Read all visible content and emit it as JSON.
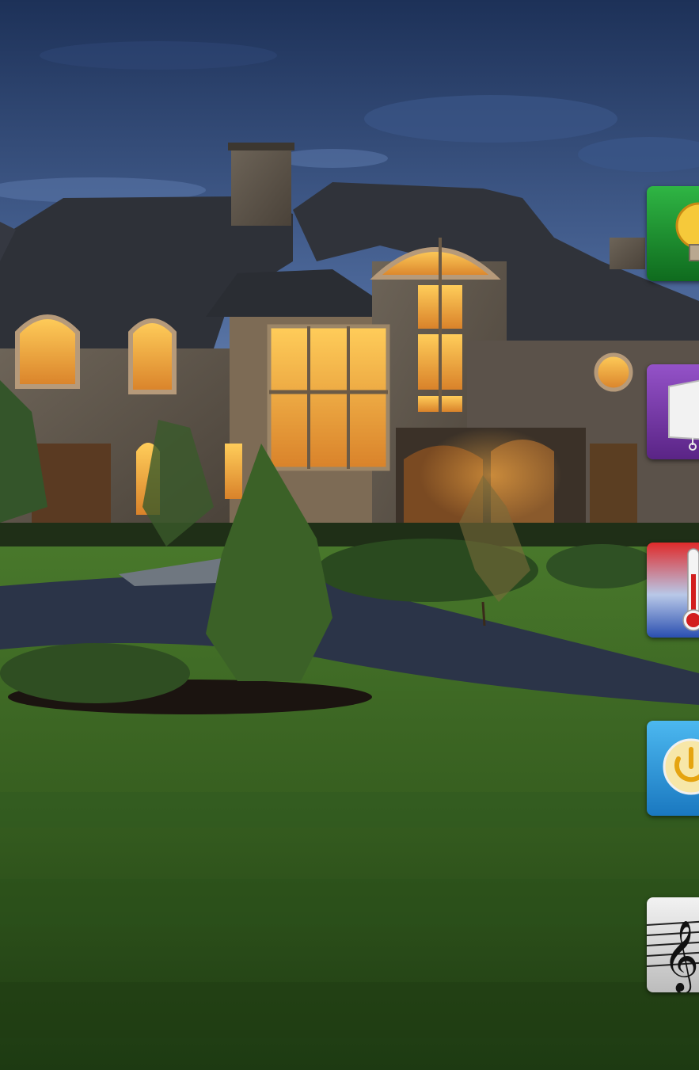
{
  "colors": {
    "top_bar": "#b0141b",
    "sky_top": "#1f3560",
    "sky_bottom": "#6f8ab6",
    "lawn": "#3d6a24",
    "window_glow": "#f5b040"
  },
  "tiles": [
    {
      "id": "lighting",
      "icon": "lightbulb-icon",
      "color": "#1c8a2e"
    },
    {
      "id": "projector",
      "icon": "projector-screen-icon",
      "color": "#7c3ea8"
    },
    {
      "id": "climate",
      "icon": "thermometer-icon",
      "color": "#c8202a"
    },
    {
      "id": "power",
      "icon": "power-icon",
      "color": "#2f9ad8"
    },
    {
      "id": "music",
      "icon": "music-notes-icon",
      "color": "#d8d8d8"
    }
  ]
}
